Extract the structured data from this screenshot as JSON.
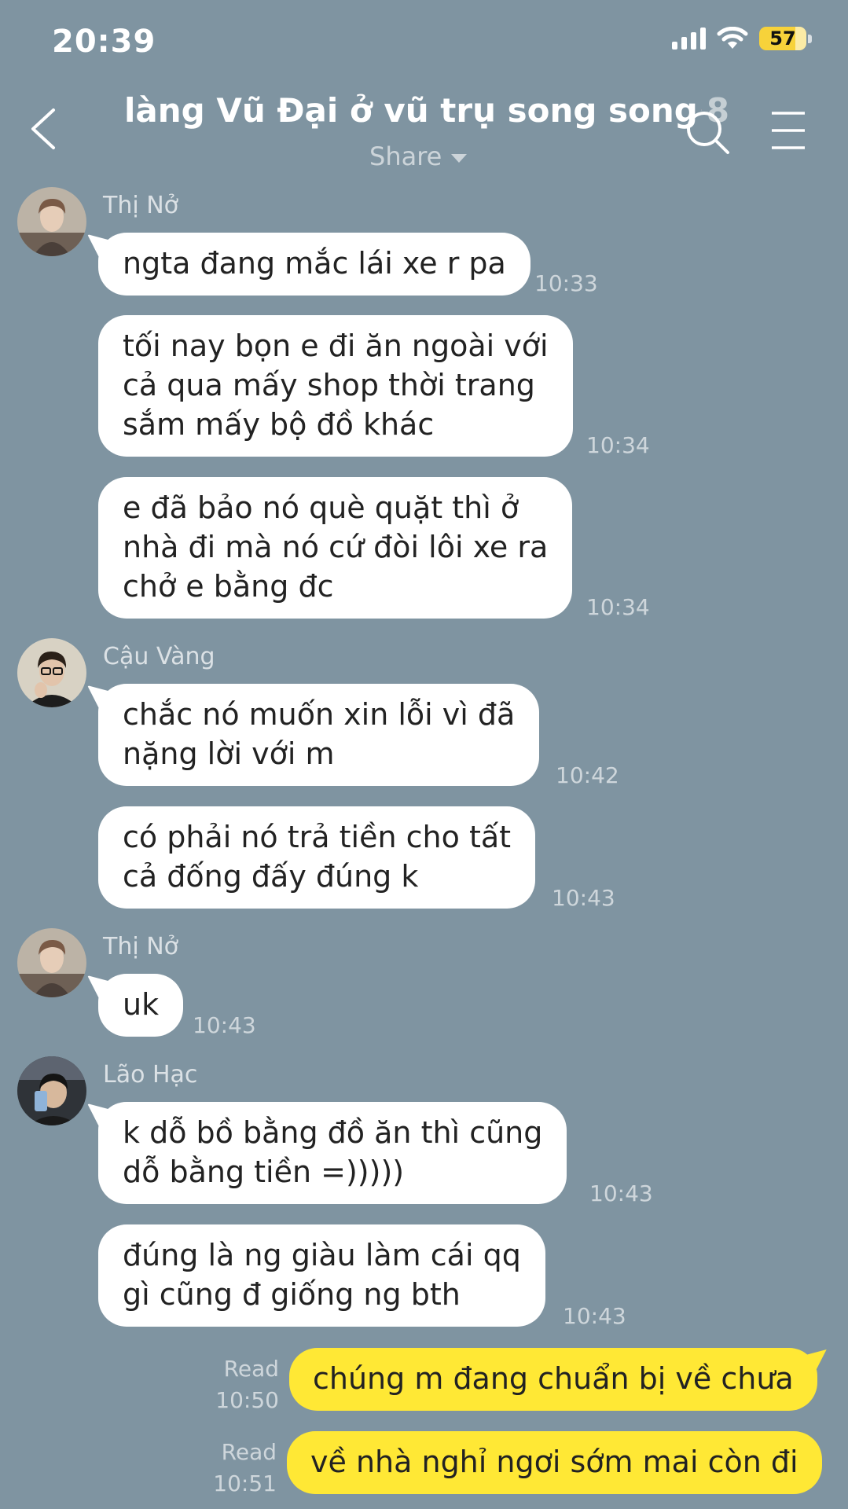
{
  "status_bar": {
    "time": "20:39",
    "battery": "57"
  },
  "header": {
    "title": "làng Vũ Đại ở vũ trụ song song",
    "member_count": "8",
    "share_label": "Share"
  },
  "messages": [
    {
      "sender": "Thị Nở",
      "text": [
        "ngta đang mắc lái xe r pa"
      ],
      "time": "10:33"
    },
    {
      "text": [
        "tối nay bọn e đi ăn ngoài với",
        "cả qua mấy shop thời trang",
        "sắm mấy bộ đồ khác"
      ],
      "time": "10:34"
    },
    {
      "text": [
        "e đã bảo nó què quặt thì ở",
        "nhà đi mà nó cứ đòi lôi xe ra",
        "chở e bằng đc"
      ],
      "time": "10:34"
    },
    {
      "sender": "Cậu Vàng",
      "text": [
        "chắc nó muốn xin lỗi vì đã",
        "nặng lời với m"
      ],
      "time": "10:42"
    },
    {
      "text": [
        "có phải nó trả tiền cho tất",
        "cả đống đấy đúng k"
      ],
      "time": "10:43"
    },
    {
      "sender": "Thị Nở",
      "text": [
        "uk"
      ],
      "time": "10:43"
    },
    {
      "sender": "Lão Hạc",
      "text": [
        "k dỗ bồ bằng đồ ăn thì cũng",
        "dỗ bằng tiền =)))))"
      ],
      "time": "10:43"
    },
    {
      "text": [
        "đúng là ng giàu làm cái qq",
        "gì cũng đ giống ng bth"
      ],
      "time": "10:43"
    }
  ],
  "outgoing": [
    {
      "read_label": "Read",
      "time": "10:50",
      "text": "chúng m đang chuẩn bị về chưa"
    },
    {
      "read_label": "Read",
      "time": "10:51",
      "text": "về nhà nghỉ ngơi sớm mai còn đi"
    }
  ],
  "colors": {
    "background": "#7f94a1",
    "incoming_bubble": "#ffffff",
    "outgoing_bubble": "#ffe835",
    "battery": "#f7d23a"
  },
  "icons": [
    "back-arrow-icon",
    "search-icon",
    "menu-icon",
    "clown-emoji-icon",
    "signal-icon",
    "wifi-icon",
    "battery-icon"
  ]
}
